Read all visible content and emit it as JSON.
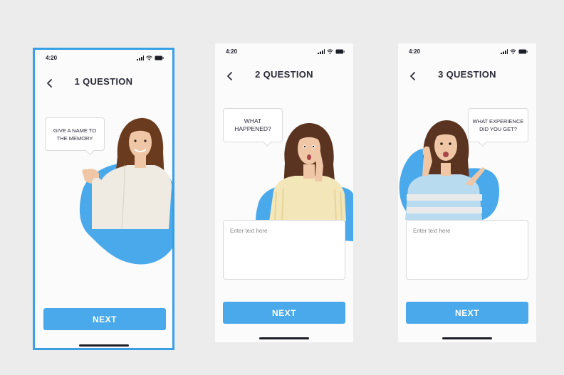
{
  "status_bar": {
    "time": "4:20"
  },
  "colors": {
    "accent": "#4aa9ea",
    "selection_border": "#3aa0e6",
    "skin": "#efc7a6",
    "hair": "#6b3b1f"
  },
  "screens": [
    {
      "title": "1 QUESTION",
      "bubble": "GIVE A NAME TO THE MEMORY",
      "button": "NEXT"
    },
    {
      "title": "2 QUESTION",
      "bubble": "WHAT HAPPENED?",
      "placeholder": "Enter text here",
      "button": "NEXT"
    },
    {
      "title": "3 QUESTION",
      "bubble": "WHAT EXPERIENCE DID YOU GET?",
      "placeholder": "Enter text here",
      "button": "NEXT"
    }
  ],
  "icons": [
    "back-arrow-icon",
    "cellular-signal-icon",
    "wifi-icon",
    "battery-icon"
  ]
}
